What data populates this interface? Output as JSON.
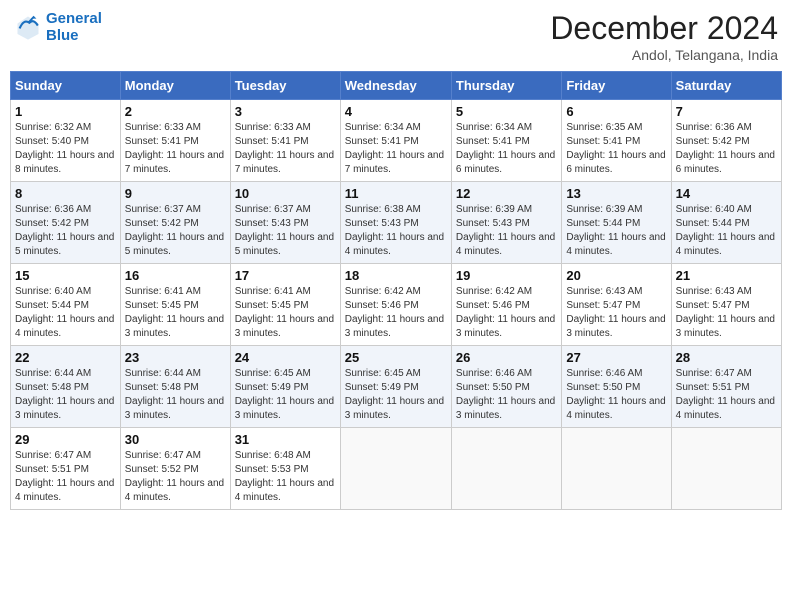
{
  "header": {
    "logo_line1": "General",
    "logo_line2": "Blue",
    "month": "December 2024",
    "location": "Andol, Telangana, India"
  },
  "columns": [
    "Sunday",
    "Monday",
    "Tuesday",
    "Wednesday",
    "Thursday",
    "Friday",
    "Saturday"
  ],
  "weeks": [
    [
      {
        "day": "1",
        "sunrise": "6:32 AM",
        "sunset": "5:40 PM",
        "daylight": "11 hours and 8 minutes."
      },
      {
        "day": "2",
        "sunrise": "6:33 AM",
        "sunset": "5:41 PM",
        "daylight": "11 hours and 7 minutes."
      },
      {
        "day": "3",
        "sunrise": "6:33 AM",
        "sunset": "5:41 PM",
        "daylight": "11 hours and 7 minutes."
      },
      {
        "day": "4",
        "sunrise": "6:34 AM",
        "sunset": "5:41 PM",
        "daylight": "11 hours and 7 minutes."
      },
      {
        "day": "5",
        "sunrise": "6:34 AM",
        "sunset": "5:41 PM",
        "daylight": "11 hours and 6 minutes."
      },
      {
        "day": "6",
        "sunrise": "6:35 AM",
        "sunset": "5:41 PM",
        "daylight": "11 hours and 6 minutes."
      },
      {
        "day": "7",
        "sunrise": "6:36 AM",
        "sunset": "5:42 PM",
        "daylight": "11 hours and 6 minutes."
      }
    ],
    [
      {
        "day": "8",
        "sunrise": "6:36 AM",
        "sunset": "5:42 PM",
        "daylight": "11 hours and 5 minutes."
      },
      {
        "day": "9",
        "sunrise": "6:37 AM",
        "sunset": "5:42 PM",
        "daylight": "11 hours and 5 minutes."
      },
      {
        "day": "10",
        "sunrise": "6:37 AM",
        "sunset": "5:43 PM",
        "daylight": "11 hours and 5 minutes."
      },
      {
        "day": "11",
        "sunrise": "6:38 AM",
        "sunset": "5:43 PM",
        "daylight": "11 hours and 4 minutes."
      },
      {
        "day": "12",
        "sunrise": "6:39 AM",
        "sunset": "5:43 PM",
        "daylight": "11 hours and 4 minutes."
      },
      {
        "day": "13",
        "sunrise": "6:39 AM",
        "sunset": "5:44 PM",
        "daylight": "11 hours and 4 minutes."
      },
      {
        "day": "14",
        "sunrise": "6:40 AM",
        "sunset": "5:44 PM",
        "daylight": "11 hours and 4 minutes."
      }
    ],
    [
      {
        "day": "15",
        "sunrise": "6:40 AM",
        "sunset": "5:44 PM",
        "daylight": "11 hours and 4 minutes."
      },
      {
        "day": "16",
        "sunrise": "6:41 AM",
        "sunset": "5:45 PM",
        "daylight": "11 hours and 3 minutes."
      },
      {
        "day": "17",
        "sunrise": "6:41 AM",
        "sunset": "5:45 PM",
        "daylight": "11 hours and 3 minutes."
      },
      {
        "day": "18",
        "sunrise": "6:42 AM",
        "sunset": "5:46 PM",
        "daylight": "11 hours and 3 minutes."
      },
      {
        "day": "19",
        "sunrise": "6:42 AM",
        "sunset": "5:46 PM",
        "daylight": "11 hours and 3 minutes."
      },
      {
        "day": "20",
        "sunrise": "6:43 AM",
        "sunset": "5:47 PM",
        "daylight": "11 hours and 3 minutes."
      },
      {
        "day": "21",
        "sunrise": "6:43 AM",
        "sunset": "5:47 PM",
        "daylight": "11 hours and 3 minutes."
      }
    ],
    [
      {
        "day": "22",
        "sunrise": "6:44 AM",
        "sunset": "5:48 PM",
        "daylight": "11 hours and 3 minutes."
      },
      {
        "day": "23",
        "sunrise": "6:44 AM",
        "sunset": "5:48 PM",
        "daylight": "11 hours and 3 minutes."
      },
      {
        "day": "24",
        "sunrise": "6:45 AM",
        "sunset": "5:49 PM",
        "daylight": "11 hours and 3 minutes."
      },
      {
        "day": "25",
        "sunrise": "6:45 AM",
        "sunset": "5:49 PM",
        "daylight": "11 hours and 3 minutes."
      },
      {
        "day": "26",
        "sunrise": "6:46 AM",
        "sunset": "5:50 PM",
        "daylight": "11 hours and 3 minutes."
      },
      {
        "day": "27",
        "sunrise": "6:46 AM",
        "sunset": "5:50 PM",
        "daylight": "11 hours and 4 minutes."
      },
      {
        "day": "28",
        "sunrise": "6:47 AM",
        "sunset": "5:51 PM",
        "daylight": "11 hours and 4 minutes."
      }
    ],
    [
      {
        "day": "29",
        "sunrise": "6:47 AM",
        "sunset": "5:51 PM",
        "daylight": "11 hours and 4 minutes."
      },
      {
        "day": "30",
        "sunrise": "6:47 AM",
        "sunset": "5:52 PM",
        "daylight": "11 hours and 4 minutes."
      },
      {
        "day": "31",
        "sunrise": "6:48 AM",
        "sunset": "5:53 PM",
        "daylight": "11 hours and 4 minutes."
      },
      null,
      null,
      null,
      null
    ]
  ],
  "labels": {
    "sunrise": "Sunrise:",
    "sunset": "Sunset:",
    "daylight": "Daylight:"
  }
}
